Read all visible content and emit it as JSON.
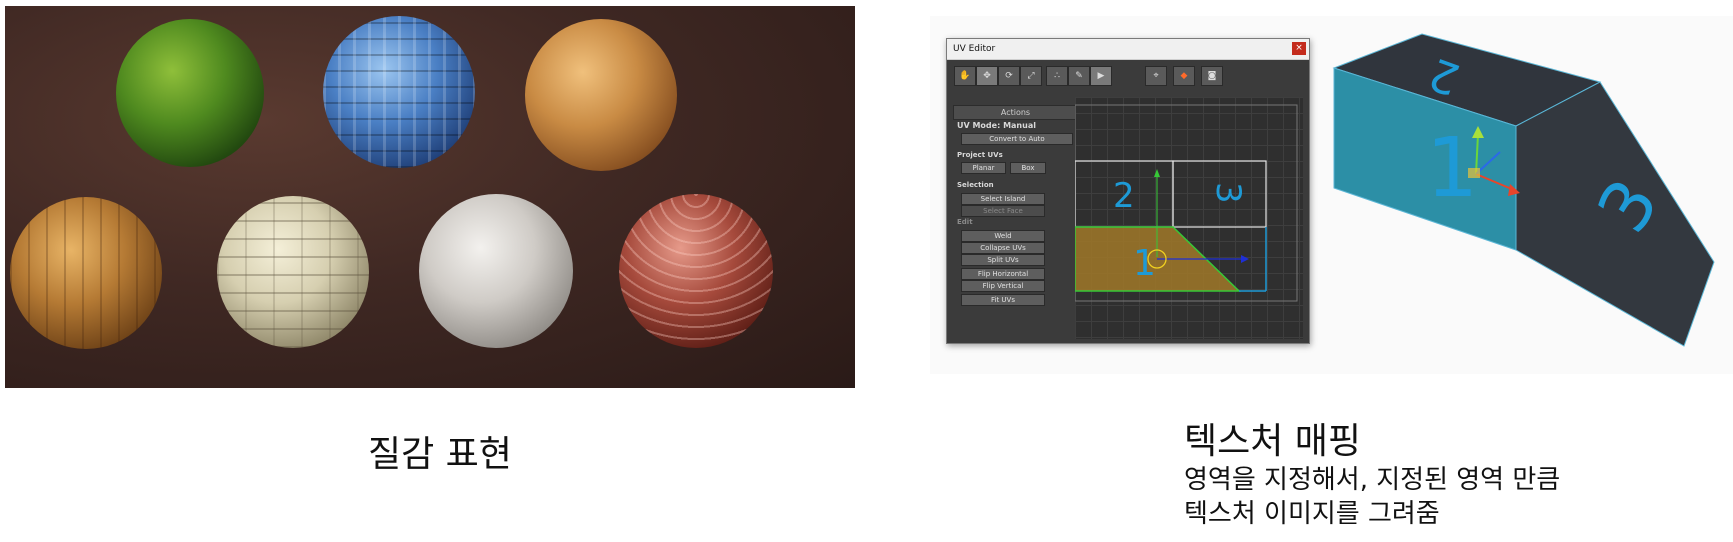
{
  "left_panel": {
    "caption": "질감 표현"
  },
  "uv_editor": {
    "title": "UV Editor",
    "close_glyph": "×",
    "tools": [
      "✋",
      "✥",
      "⟳",
      "⤢",
      "∴",
      "✎",
      "▶",
      "⌖",
      "◆",
      "◙"
    ],
    "actions_header": "Actions",
    "uv_mode": "UV Mode: Manual",
    "convert_to_auto": "Convert to Auto",
    "project_uvs_label": "Project UVs",
    "planar": "Planar",
    "box": "Box",
    "selection_label": "Selection",
    "select_island": "Select Island",
    "select_face": "Select Face",
    "edit_label": "Edit",
    "weld": "Weld",
    "collapse_uvs": "Collapse UVs",
    "split_uvs": "Split UVs",
    "flip_horizontal": "Flip Horizontal",
    "flip_vertical": "Flip Vertical",
    "fit_uvs": "Fit UVs",
    "face_labels": [
      "2",
      "3",
      "1"
    ]
  },
  "box_model": {
    "face_labels": [
      "2",
      "1",
      "3"
    ]
  },
  "right_panel": {
    "caption": "텍스처 매핑",
    "description_line1": "영역을 지정해서, 지정된 영역 만큼",
    "description_line2": "텍스처 이미지를 그려줌"
  },
  "colors": {
    "accent_cyan": "#1e9ad6",
    "box_teal": "#2c8fa6",
    "uv_face_fill": "#a07828",
    "uv_green": "#37c837"
  }
}
